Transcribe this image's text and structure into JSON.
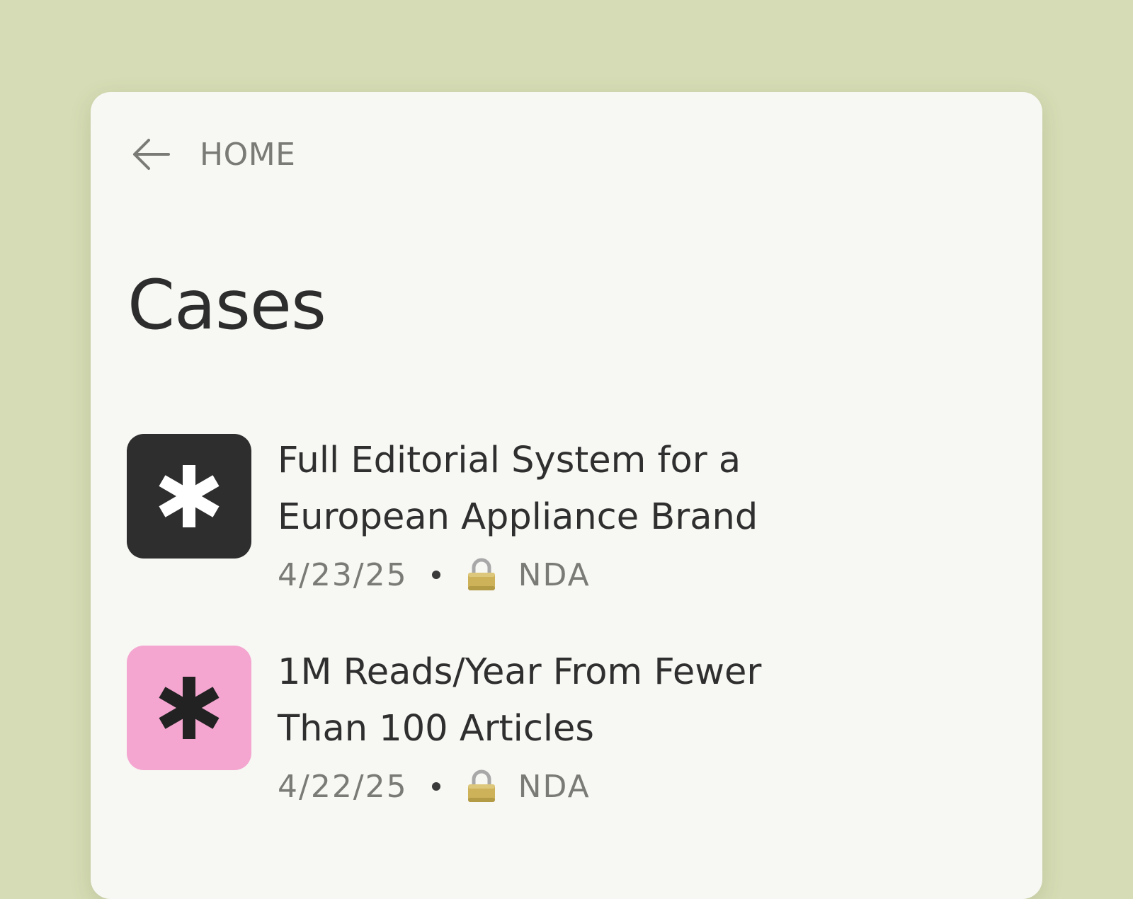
{
  "nav": {
    "back_label": "HOME"
  },
  "page": {
    "title": "Cases"
  },
  "cases": [
    {
      "title_line1": "Full Editorial System for a",
      "title_line2": "European Appliance Brand",
      "date": "4/23/25",
      "tag": "NDA",
      "thumb_color": "#2e2e2e",
      "icon_color": "#ffffff",
      "icon": "asterisk-icon"
    },
    {
      "title_line1": "1M Reads/Year From Fewer",
      "title_line2": "Than 100 Articles",
      "date": "4/22/25",
      "tag": "NDA",
      "thumb_color": "#f4a6d0",
      "icon_color": "#222222",
      "icon": "asterisk-icon"
    }
  ],
  "colors": {
    "background": "#d6dcb5",
    "card": "#f7f7f3",
    "text_primary": "#2d2d2d",
    "text_muted": "#7a7a76"
  }
}
